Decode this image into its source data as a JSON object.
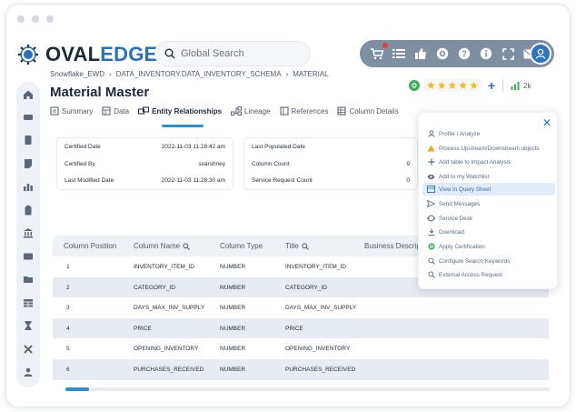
{
  "app": {
    "logo_primary": "OVAL",
    "logo_accent": "EDGE",
    "search_placeholder": "Global Search"
  },
  "breadcrumb": [
    "Snowflake_EWD",
    "›",
    "DATA_INVENTORY.DATA_INVENTORY_SCHEMA",
    "›",
    "MATERIAL"
  ],
  "page_title": "Material Master",
  "rating": {
    "stars": 5,
    "count": "2k"
  },
  "tabs": [
    {
      "label": "Summary",
      "icon": "summary-icon"
    },
    {
      "label": "Data",
      "icon": "data-icon"
    },
    {
      "label": "Entity Relationships",
      "icon": "relationships-icon"
    },
    {
      "label": "Lineage",
      "icon": "lineage-icon"
    },
    {
      "label": "References",
      "icon": "references-icon"
    },
    {
      "label": "Column Details",
      "icon": "column-details-icon"
    }
  ],
  "active_tab": "Entity Relationships",
  "details_left": [
    {
      "label": "Certified Date",
      "value": "2022-11-03 11:28:42 am"
    },
    {
      "label": "Certified By",
      "value": "svarshney"
    },
    {
      "label": "Last Modified Date",
      "value": "2022-11-03 11:28:30 am"
    }
  ],
  "details_right": [
    {
      "label": "Last Populated Date",
      "value": ""
    },
    {
      "label": "Column Count",
      "value": "9"
    },
    {
      "label": "Service Request Count",
      "value": "0"
    }
  ],
  "table": {
    "headers": [
      "Column Position",
      "Column Name",
      "Column Type",
      "Title",
      "Business Descrip"
    ],
    "rows": [
      [
        "1",
        "INVENTORY_ITEM_ID",
        "NUMBER",
        "INVENTORY_ITEM_ID"
      ],
      [
        "2",
        "CATEGORY_ID",
        "NUMBER",
        "CATEGORY_ID"
      ],
      [
        "3",
        "DAYS_MAX_INV_SUPPLY",
        "NUMBER",
        "DAYS_MAX_INV_SUPPLY"
      ],
      [
        "4",
        "PRICE",
        "NUMBER",
        "PRICE"
      ],
      [
        "5",
        "OPENING_INVENTORY",
        "NUMBER",
        "OPENING_INVENTORY"
      ],
      [
        "6",
        "PURCHASES_RECEIVED",
        "NUMBER",
        "PURCHASES_RECEIVED"
      ]
    ]
  },
  "menu": {
    "items": [
      {
        "label": "Profile / Analyze",
        "icon": "profile-icon"
      },
      {
        "label": "Process Upstream/Downstream objects",
        "icon": "warning-icon"
      },
      {
        "label": "Add table to Impact Analysis",
        "icon": "plus-icon"
      },
      {
        "label": "Add to my Watchlist",
        "icon": "eye-icon"
      },
      {
        "label": "View in Query Sheet",
        "icon": "query-sheet-icon"
      },
      {
        "label": "Send Messages",
        "icon": "send-icon"
      },
      {
        "label": "Service Desk",
        "icon": "service-desk-icon"
      },
      {
        "label": "Download",
        "icon": "download-icon"
      },
      {
        "label": "Apply Certification",
        "icon": "certification-icon"
      },
      {
        "label": "Configure Search Keywords",
        "icon": "search-config-icon"
      },
      {
        "label": "External Access Request",
        "icon": "external-access-icon"
      }
    ],
    "highlighted": "View in Query Sheet"
  },
  "colors": {
    "brand": "#2b6fb8",
    "accent": "#2b8fd6",
    "toolbar": "#7f8fa3",
    "star": "#f2b81c",
    "certified": "#3fae5a",
    "warning": "#f2a31c"
  }
}
